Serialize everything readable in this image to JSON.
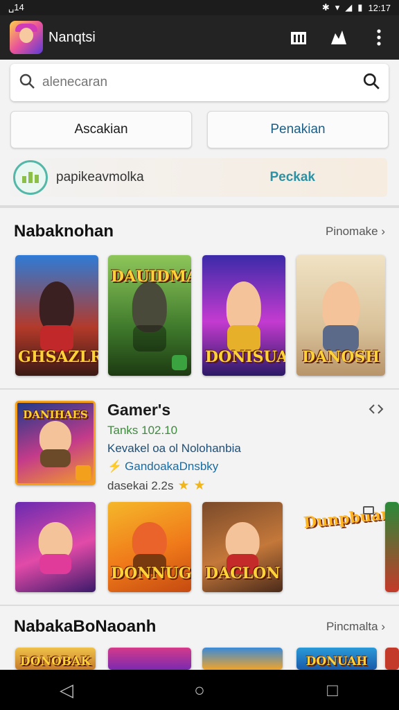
{
  "status": {
    "left": "␣14",
    "right": "12:17"
  },
  "appbar": {
    "title": "Nanqtsi",
    "icons": [
      "store-icon",
      "account-icon",
      "more-vert-icon"
    ]
  },
  "search": {
    "placeholder": "alenecaran"
  },
  "buttons": {
    "left": "Ascakian",
    "right": "Penakian"
  },
  "promo": {
    "text": "papikeavmolka",
    "cta": "Peckak"
  },
  "section1": {
    "title": "Nabaknohan",
    "more": "Pinomake ›",
    "tiles": [
      {
        "label": "GHSAZLR"
      },
      {
        "label": "DAUIDMA"
      },
      {
        "label": "DONISUA"
      },
      {
        "label": "DANOSH"
      }
    ]
  },
  "featured": {
    "badge_label": "DANIHAES",
    "name": "Gamer's",
    "line1": "Tanks 102.10",
    "line2": "Kevakel oa ol Nolohanbia",
    "line3": "GandoakaDnsbky",
    "line4": "dasekai 2.2s",
    "stars": [
      "★",
      "★"
    ],
    "share_icon": "share-icon"
  },
  "row2": {
    "tiles": [
      {
        "label": ""
      },
      {
        "label": "DONNUG"
      },
      {
        "label": "DACLON"
      }
    ],
    "wordmark": "Dunpbuan"
  },
  "section2": {
    "title": "NabakaBoNaoanh",
    "more": "Pincmalta ›",
    "tiles": [
      {
        "label": "DONOBAK"
      },
      {
        "label": ""
      },
      {
        "label": ""
      },
      {
        "label": "DONUAH"
      }
    ]
  },
  "nav": {
    "back": "◁",
    "home": "○",
    "recents": "□"
  },
  "colors": {
    "appbar": "#232323",
    "accent_blue": "#1b5e86",
    "teal": "#2b91a4",
    "star": "#f1b51c"
  }
}
